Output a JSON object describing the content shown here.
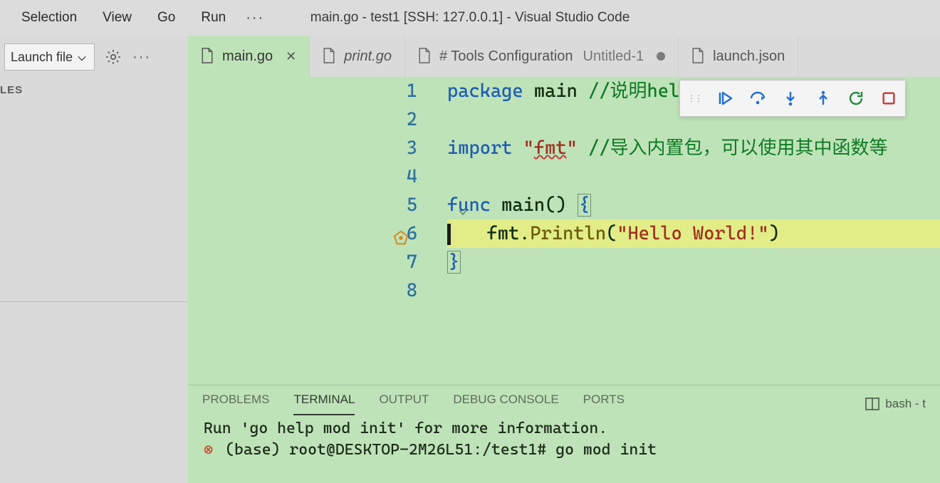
{
  "menu": {
    "items": [
      "Selection",
      "View",
      "Go",
      "Run"
    ],
    "more": "···"
  },
  "window_title": "main.go - test1 [SSH: 127.0.0.1] - Visual Studio Code",
  "sidebar": {
    "launch_label": "Launch file",
    "section": "LES"
  },
  "tabs": [
    {
      "label": "main.go",
      "italic": false,
      "active": true,
      "closeable": true
    },
    {
      "label": "print.go",
      "italic": true,
      "active": false,
      "closeable": false
    },
    {
      "label": "# Tools Configuration",
      "sublabel": "Untitled-1",
      "italic": false,
      "active": false,
      "dirty": true
    },
    {
      "label": "launch.json",
      "italic": false,
      "active": false
    }
  ],
  "code": {
    "lines": [
      {
        "n": 1,
        "segs": [
          [
            "kw",
            "package "
          ],
          [
            "id",
            "main "
          ],
          [
            "cm",
            "//说明hello.go这个文件"
          ]
        ]
      },
      {
        "n": 2,
        "segs": []
      },
      {
        "n": 3,
        "segs": [
          [
            "kw",
            "import "
          ],
          [
            "str",
            "\""
          ],
          [
            "imp",
            "fmt"
          ],
          [
            "str",
            "\" "
          ],
          [
            "cm",
            "//导入内置包，可以使用其中函数等"
          ]
        ]
      },
      {
        "n": 4,
        "segs": []
      },
      {
        "n": 5,
        "segs": [
          [
            "kw",
            "func "
          ],
          [
            "id",
            "main"
          ],
          [
            "id",
            "() "
          ],
          [
            "brace_open",
            "{"
          ]
        ],
        "fold": true
      },
      {
        "n": 6,
        "segs": [
          [
            "txt",
            "  fmt."
          ],
          [
            "fn",
            "Println"
          ],
          [
            "txt",
            "("
          ],
          [
            "str",
            "\"Hello World!\""
          ],
          [
            "txt",
            ")"
          ]
        ],
        "exec": true,
        "bp": true
      },
      {
        "n": 7,
        "segs": [
          [
            "brace_close",
            "}"
          ]
        ]
      },
      {
        "n": 8,
        "segs": []
      }
    ]
  },
  "debug_toolbar": {
    "buttons": [
      "continue",
      "step-over",
      "step-into",
      "step-out",
      "restart",
      "stop"
    ]
  },
  "panel": {
    "tabs": [
      "PROBLEMS",
      "TERMINAL",
      "OUTPUT",
      "DEBUG CONSOLE",
      "PORTS"
    ],
    "active_tab": "TERMINAL",
    "right_label": "bash - t",
    "terminal_lines": [
      "Run 'go help mod init' for more information.",
      "(base) root@DESKTOP-2M26L51:/test1# go mod init"
    ],
    "error_glyph": "⊗"
  }
}
